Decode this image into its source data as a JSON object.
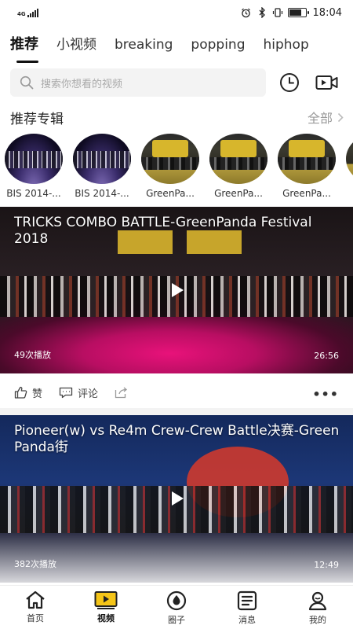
{
  "status_bar": {
    "network": "4G",
    "time": "18:04",
    "battery_level": 0.75
  },
  "tabs": [
    "推荐",
    "小视频",
    "breaking",
    "popping",
    "hiphop"
  ],
  "active_tab": "推荐",
  "search": {
    "placeholder": "搜索你想看的视频"
  },
  "albums_section": {
    "title": "推荐专辑",
    "see_all": "全部"
  },
  "albums": [
    {
      "label": "BIS 2014-...",
      "style": "bis"
    },
    {
      "label": "BIS 2014-...",
      "style": "bis"
    },
    {
      "label": "GreenPa...",
      "style": "gp"
    },
    {
      "label": "GreenPa...",
      "style": "gp"
    },
    {
      "label": "GreenPa...",
      "style": "gp"
    }
  ],
  "videos": [
    {
      "title": "TRICKS COMBO BATTLE-GreenPanda Festival 2018",
      "plays": "49次播放",
      "duration": "26:56"
    },
    {
      "title": "Pioneer(w) vs Re4m Crew-Crew Battle决赛-Green Panda街",
      "plays": "382次播放",
      "duration": "12:49"
    }
  ],
  "actions": {
    "like": "赞",
    "comment": "评论",
    "more": "•••"
  },
  "bottom_nav": [
    {
      "label": "首页",
      "icon": "home-icon"
    },
    {
      "label": "视频",
      "icon": "video-icon"
    },
    {
      "label": "圈子",
      "icon": "circle-icon"
    },
    {
      "label": "消息",
      "icon": "message-icon"
    },
    {
      "label": "我的",
      "icon": "profile-icon"
    }
  ],
  "active_nav": "视频",
  "colors": {
    "accent": "#f5c518",
    "text": "#222222",
    "muted": "#999999"
  }
}
